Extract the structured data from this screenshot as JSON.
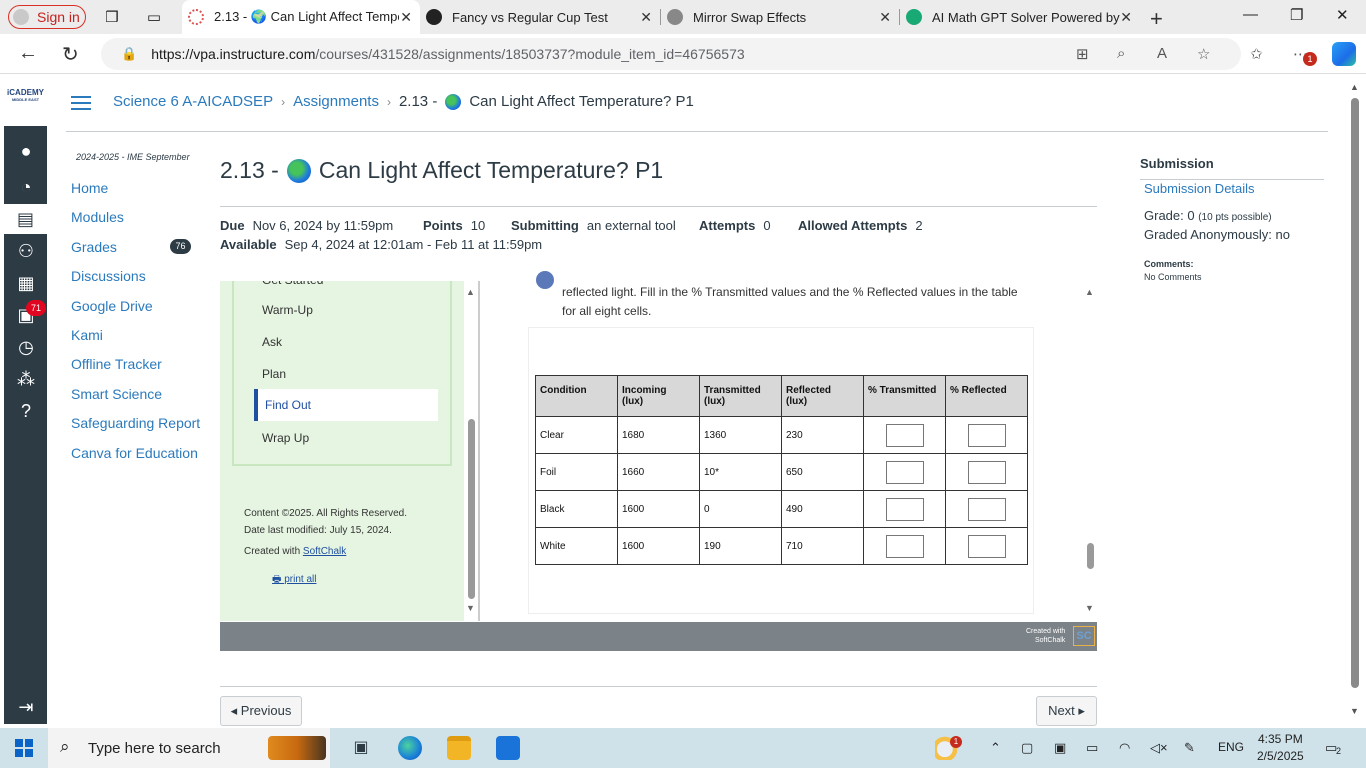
{
  "browser": {
    "signin_label": "Sign in",
    "tabs": [
      {
        "label": "2.13 - 🌍 Can Light Affect Tempe",
        "fav_color": "#ffffff",
        "ring": "#d55",
        "active": true
      },
      {
        "label": "Fancy vs Regular Cup Test",
        "fav_color": "#222222"
      },
      {
        "label": "Mirror Swap Effects",
        "fav_color": "#888888"
      },
      {
        "label": "AI Math GPT Solver Powered by G",
        "fav_color": "#19a974"
      }
    ],
    "url_host": "https://vpa.instructure.com",
    "url_path": "/courses/431528/assignments/18503737?module_item_id=46756573",
    "extension_badge": "1"
  },
  "global_nav": {
    "logo_text": "iCADEMY",
    "logo_sub": "MIDDLE EAST",
    "inbox_badge": "71"
  },
  "breadcrumb": {
    "course": "Science 6 A-AICADSEP",
    "section": "Assignments",
    "current_prefix": "2.13 -",
    "current_title": "Can Light Affect Temperature? P1"
  },
  "course_nav": {
    "term": "2024-2025 - IME September",
    "items": [
      "Home",
      "Modules",
      "Grades",
      "Discussions",
      "Google Drive",
      "Kami",
      "Offline Tracker",
      "Smart Science",
      "Safeguarding Report",
      "Canva for Education"
    ],
    "grades_badge": "76"
  },
  "assignment": {
    "title_prefix": "2.13 -",
    "title": "Can Light Affect Temperature? P1",
    "due_label": "Due",
    "due_value": "Nov 6, 2024 by 11:59pm",
    "points_label": "Points",
    "points_value": "10",
    "submitting_label": "Submitting",
    "submitting_value": "an external tool",
    "attempts_label": "Attempts",
    "attempts_value": "0",
    "allowed_label": "Allowed Attempts",
    "allowed_value": "2",
    "available_label": "Available",
    "available_value": "Sep 4, 2024 at 12:01am - Feb 11 at 11:59pm"
  },
  "lesson": {
    "partial_item": "Get Started",
    "items": [
      "Warm-Up",
      "Ask",
      "Plan",
      "Find Out",
      "Wrap Up"
    ],
    "active_item": "Find Out",
    "content_line": "Content ©2025. All Rights Reserved.",
    "modified_line": "Date last modified: July 15, 2024.",
    "created_prefix": "Created with",
    "created_link": "SoftChalk",
    "print_all": "print all",
    "instruction_line1": "reflected light. Fill in the % Transmitted values and the % Reflected values in the table",
    "instruction_line2": "for all eight cells.",
    "footer_created": "Created with",
    "footer_softchalk": "SoftChalk",
    "footer_logo": "SC"
  },
  "table": {
    "headers": [
      "Condition",
      "Incoming\n(lux)",
      "Transmitted\n(lux)",
      "Reflected\n(lux)",
      "% Transmitted",
      "% Reflected"
    ],
    "rows": [
      [
        "Clear",
        "1680",
        "1360",
        "230"
      ],
      [
        "Foil",
        "1660",
        "10*",
        "650"
      ],
      [
        "Black",
        "1600",
        "0",
        "490"
      ],
      [
        "White",
        "1600",
        "190",
        "710"
      ]
    ]
  },
  "submission": {
    "heading": "Submission",
    "details_link": "Submission Details",
    "grade_label": "Grade: 0",
    "grade_possible": "(10 pts possible)",
    "graded_anon": "Graded Anonymously: no",
    "comments_label": "Comments:",
    "comments_value": "No Comments"
  },
  "pager": {
    "previous": "◂ Previous",
    "next": "Next ▸"
  },
  "taskbar": {
    "search_placeholder": "Type here to search",
    "weather_badge": "1",
    "lang": "ENG",
    "time": "4:35 PM",
    "date": "2/5/2025",
    "notif_count": "2"
  }
}
